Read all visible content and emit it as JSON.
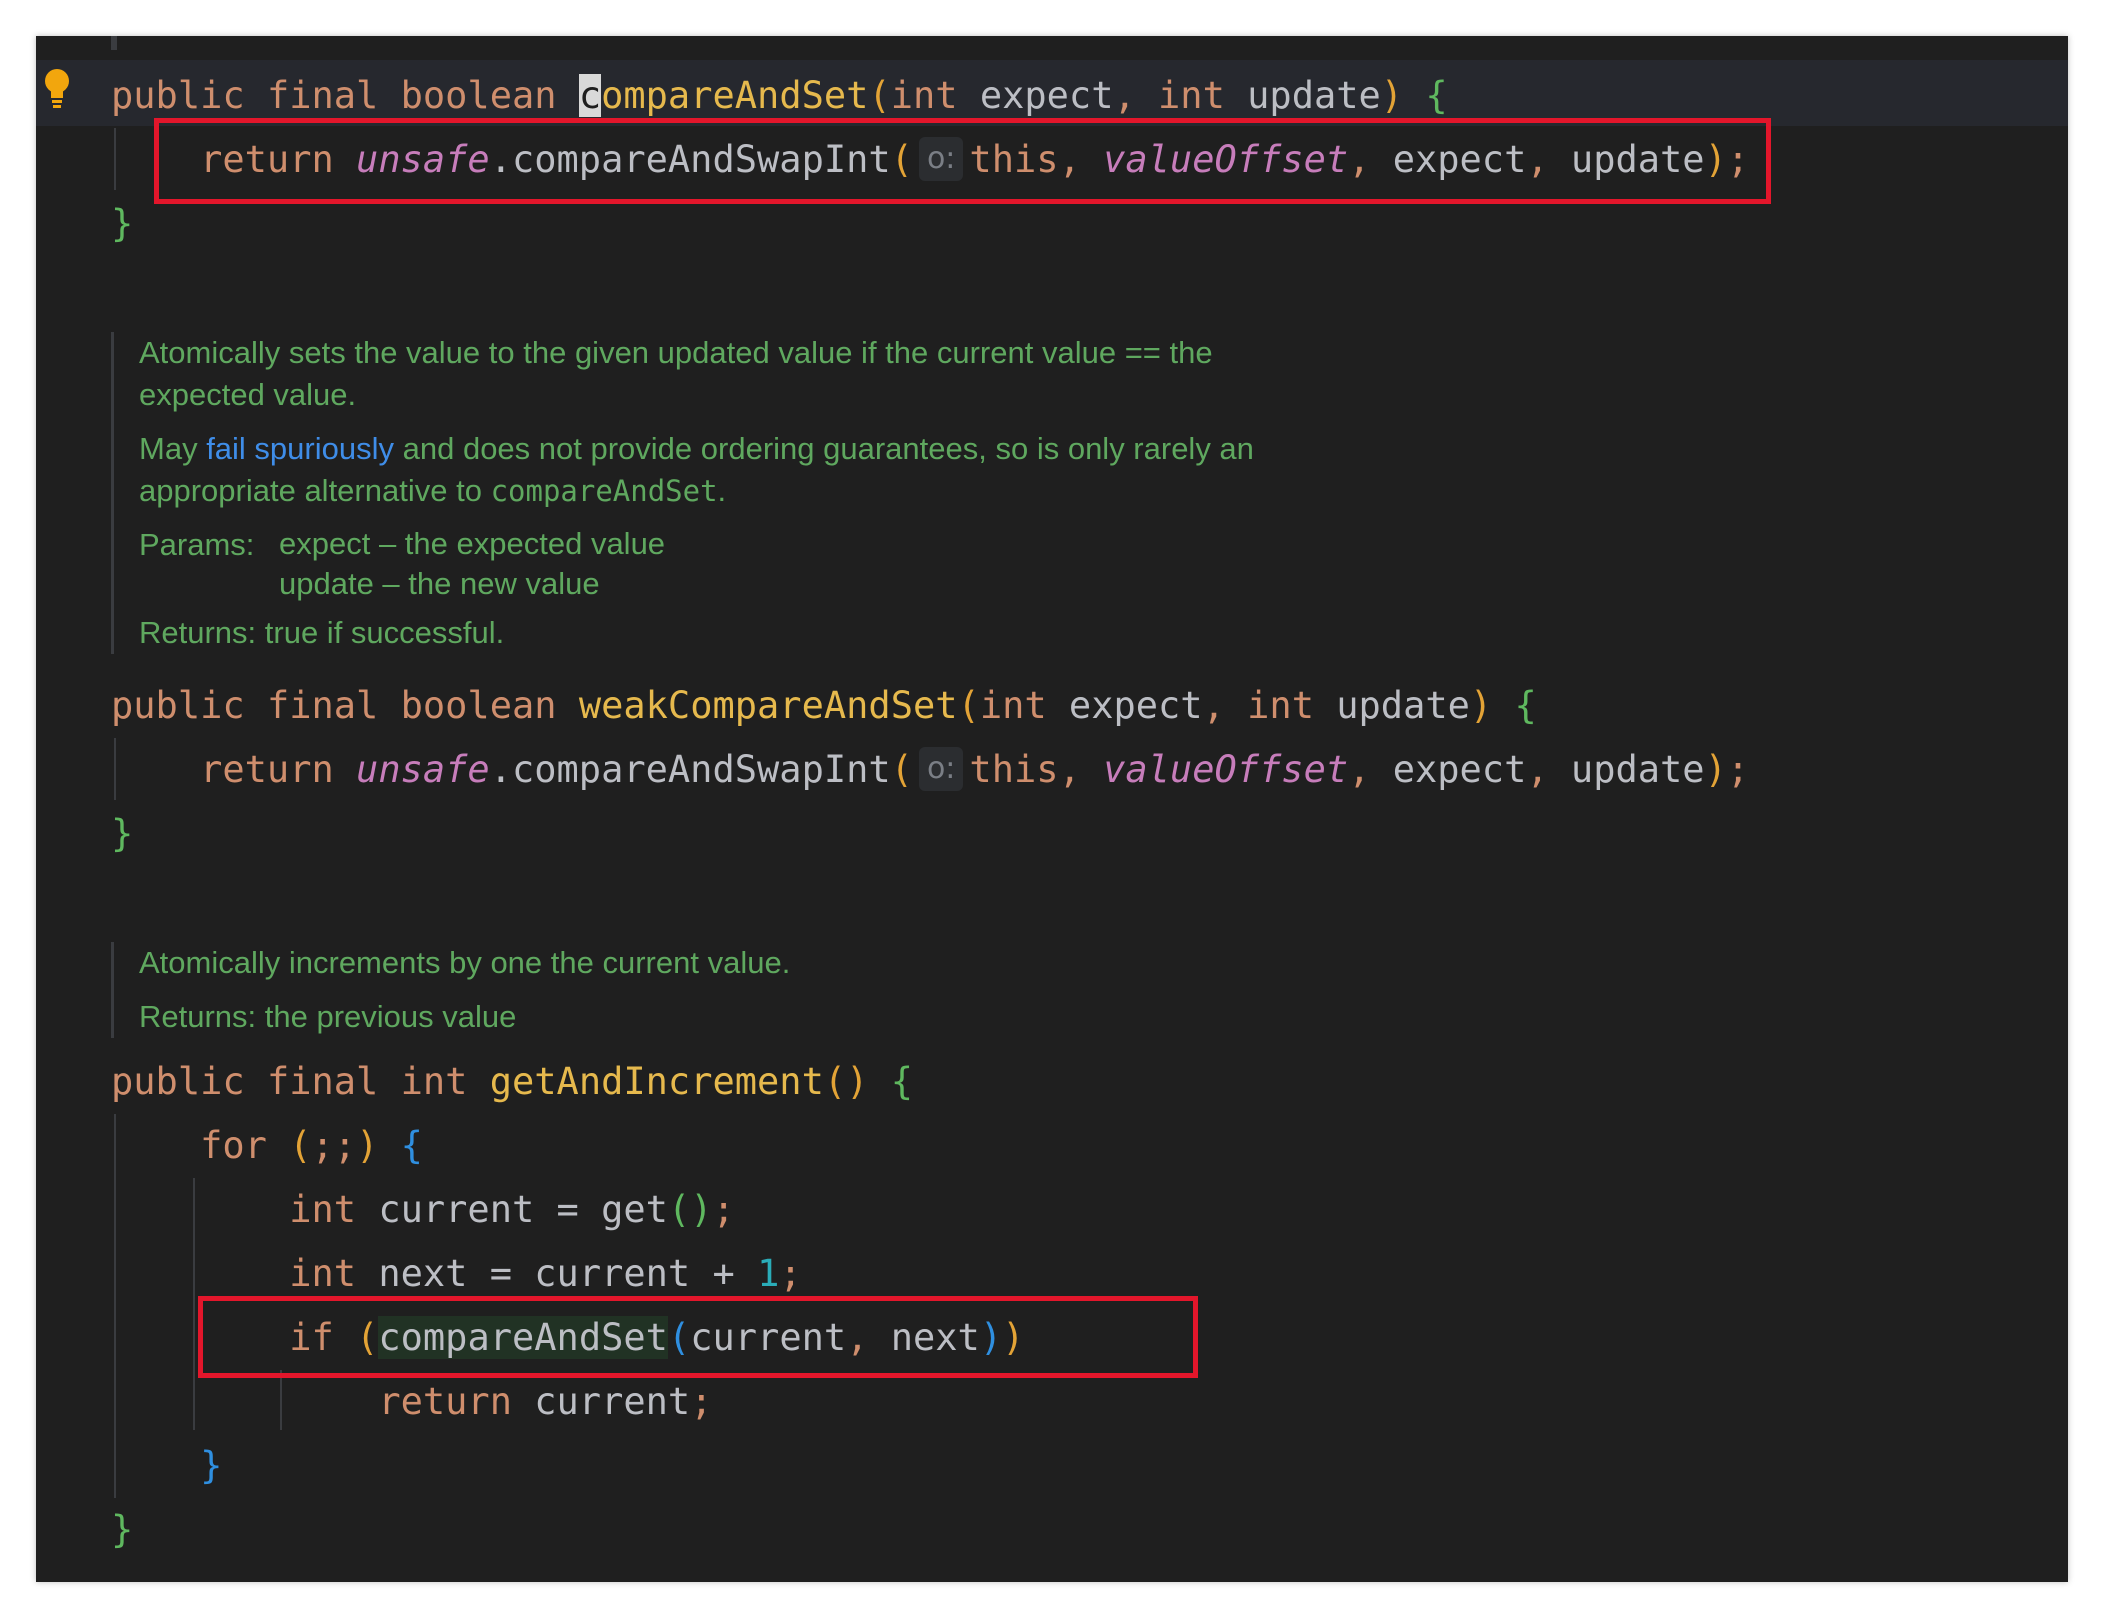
{
  "editor": {
    "line1": {
      "kw1": "public",
      "kw2": "final",
      "kw3": "boolean",
      "cursor_char": "c",
      "fn_rest": "ompareAndSet",
      "open": "(",
      "t1": "int",
      "p1": "expect",
      "comma": ",",
      "t2": "int",
      "p2": "update",
      "close": ")",
      "brace": "{"
    },
    "line2": {
      "kw": "return",
      "field": "unsafe",
      "call": ".compareAndSwapInt",
      "open": "(",
      "hint": "o:",
      "a1": "this",
      "c1": ",",
      "a2": "valueOffset",
      "c2": ",",
      "a3": "expect",
      "c3": ",",
      "a4": "update",
      "close": ")",
      "semi": ";"
    },
    "line3": {
      "brace": "}"
    },
    "doc1": {
      "p1": "Atomically sets the value to the given updated value if the current value == the expected value.",
      "p2_pre": "May ",
      "p2_link": "fail spuriously",
      "p2_mid": " and does not provide ordering guarantees, so is only rarely an appropriate alternative to ",
      "p2_code": "compareAndSet",
      "p2_end": ".",
      "params_label": "Params:",
      "param1": "expect – the expected value",
      "param2": "update – the new value",
      "returns": "Returns: true if successful."
    },
    "line4": {
      "kw1": "public",
      "kw2": "final",
      "kw3": "boolean",
      "fn": "weakCompareAndSet",
      "open": "(",
      "t1": "int",
      "p1": "expect",
      "comma": ",",
      "t2": "int",
      "p2": "update",
      "close": ")",
      "brace": "{"
    },
    "line5": {
      "kw": "return",
      "field": "unsafe",
      "call": ".compareAndSwapInt",
      "open": "(",
      "hint": "o:",
      "a1": "this",
      "c1": ",",
      "a2": "valueOffset",
      "c2": ",",
      "a3": "expect",
      "c3": ",",
      "a4": "update",
      "close": ")",
      "semi": ";"
    },
    "line6": {
      "brace": "}"
    },
    "doc2": {
      "p1": "Atomically increments by one the current value.",
      "returns": "Returns: the previous value"
    },
    "line7": {
      "kw1": "public",
      "kw2": "final",
      "kw3": "int",
      "fn": "getAndIncrement",
      "parens": "()",
      "brace": "{"
    },
    "line8": {
      "kw": "for",
      "open": "(",
      "semis": ";;",
      "close": ")",
      "brace": "{"
    },
    "line9": {
      "kw": "int",
      "var": "current",
      "eq": "=",
      "call": "get",
      "parens": "()",
      "semi": ";"
    },
    "line10": {
      "kw": "int",
      "var": "next",
      "eq": "=",
      "ref": "current",
      "plus": "+",
      "num": "1",
      "semi": ";"
    },
    "line11": {
      "kw": "if",
      "open": "(",
      "call": "compareAndSet",
      "open2": "(",
      "a1": "current",
      "comma": ",",
      "a2": "next",
      "close2": ")",
      "close": ")"
    },
    "line12": {
      "kw": "return",
      "ref": "current",
      "semi": ";"
    },
    "line13": {
      "brace": "}"
    },
    "line14": {
      "brace": "}"
    }
  }
}
